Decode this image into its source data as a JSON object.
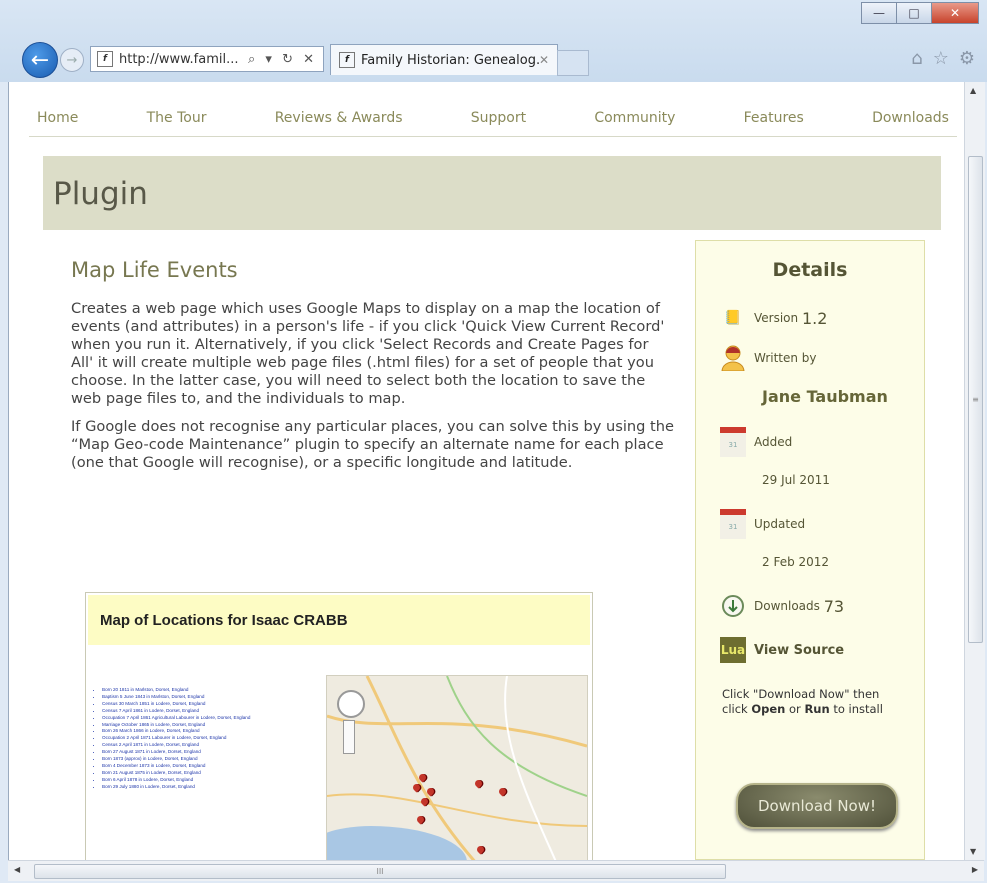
{
  "browser": {
    "address": "http://www.famil...",
    "address_controls": "⌕ ▾ ↻ ✕",
    "tab_title": "Family Historian: Genealog...",
    "tab_close": "✕",
    "window_buttons": {
      "minimize": "—",
      "maximize": "□",
      "close": "✕"
    }
  },
  "nav": [
    "Home",
    "The Tour",
    "Reviews & Awards",
    "Support",
    "Community",
    "Features",
    "Downloads"
  ],
  "page_title": "Plugin",
  "plugin": {
    "name": "Map Life Events",
    "paragraph1": "Creates a web page which uses Google Maps to display on a map the location of events (and attributes) in a person's life - if you click 'Quick View Current Record' when you run it. Alternatively, if you click 'Select Records and Create Pages for All' it will create multiple web page files (.html files) for a set of people that you choose. In the latter case, you will need to select both the location to save the web page files to, and the individuals to map.",
    "paragraph2": "If Google does not recognise any particular places, you can solve this by using the “Map Geo-code Maintenance” plugin to specify an alternate name for each place (one that Google will recognise), or a specific longitude and latitude."
  },
  "screenshot": {
    "title": "Map of Locations for Isaac CRABB",
    "events": [
      "Born 20 1811 in Marlston, Dorset, England",
      "Baptism 5 June 1843 in Marlston, Dorset, England",
      "Census 30 March 1851 in Lodere, Dorset, England",
      "Census 7 April 1861 in Lodere, Dorset, England",
      "Occupation 7 April 1861 Agricultural Labourer in Lodere, Dorset, England",
      "Marriage October 1865 in Lodere, Dorset, England",
      "Born 26 March 1866 in Lodere, Dorset, England",
      "Occupation 2 April 1871 Labourer in Lodere, Dorset, England",
      "Census 2 April 1871 in Lodere, Dorset, England",
      "Born 27 August 1871 in Lodere, Dorset, England",
      "Born 1873 (approx) in Lodere, Dorset, England",
      "Born 4 December 1873 in Lodere, Dorset, England",
      "Born 21 August 1875 in Lodere, Dorset, England",
      "Born 6 April 1878 in Lodere, Dorset, England",
      "Born 29 July 1880 in Lodere, Dorset, England"
    ]
  },
  "details": {
    "heading": "Details",
    "version_label": "Version",
    "version": "1.2",
    "written_by_label": "Written by",
    "author": "Jane Taubman",
    "added_label": "Added",
    "added_date": "29 Jul 2011",
    "updated_label": "Updated",
    "updated_date": "2 Feb 2012",
    "downloads_label": "Downloads",
    "downloads": "73",
    "lua_label": "Lua",
    "view_source": "View Source",
    "note_pre": "Click \"Download Now\" then click ",
    "note_open": "Open",
    "note_or": " or ",
    "note_run": "Run",
    "note_post": " to install",
    "download_button": "Download Now!",
    "calendar_text": "31"
  },
  "scroll": {
    "grip": "≡",
    "hgrip": "III"
  },
  "colors": {
    "accent": "#777750",
    "hero_bg": "#dcddc8",
    "sidebar_bg": "#fdfde8",
    "browser_blue": "#1a5cb0"
  }
}
